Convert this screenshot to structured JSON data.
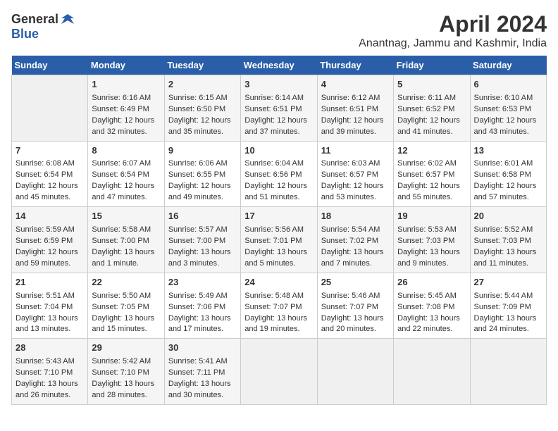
{
  "header": {
    "logo_general": "General",
    "logo_blue": "Blue",
    "month_year": "April 2024",
    "location": "Anantnag, Jammu and Kashmir, India"
  },
  "days_of_week": [
    "Sunday",
    "Monday",
    "Tuesday",
    "Wednesday",
    "Thursday",
    "Friday",
    "Saturday"
  ],
  "weeks": [
    [
      {
        "day": "",
        "data": ""
      },
      {
        "day": "1",
        "data": "Sunrise: 6:16 AM\nSunset: 6:49 PM\nDaylight: 12 hours and 32 minutes."
      },
      {
        "day": "2",
        "data": "Sunrise: 6:15 AM\nSunset: 6:50 PM\nDaylight: 12 hours and 35 minutes."
      },
      {
        "day": "3",
        "data": "Sunrise: 6:14 AM\nSunset: 6:51 PM\nDaylight: 12 hours and 37 minutes."
      },
      {
        "day": "4",
        "data": "Sunrise: 6:12 AM\nSunset: 6:51 PM\nDaylight: 12 hours and 39 minutes."
      },
      {
        "day": "5",
        "data": "Sunrise: 6:11 AM\nSunset: 6:52 PM\nDaylight: 12 hours and 41 minutes."
      },
      {
        "day": "6",
        "data": "Sunrise: 6:10 AM\nSunset: 6:53 PM\nDaylight: 12 hours and 43 minutes."
      }
    ],
    [
      {
        "day": "7",
        "data": "Sunrise: 6:08 AM\nSunset: 6:54 PM\nDaylight: 12 hours and 45 minutes."
      },
      {
        "day": "8",
        "data": "Sunrise: 6:07 AM\nSunset: 6:54 PM\nDaylight: 12 hours and 47 minutes."
      },
      {
        "day": "9",
        "data": "Sunrise: 6:06 AM\nSunset: 6:55 PM\nDaylight: 12 hours and 49 minutes."
      },
      {
        "day": "10",
        "data": "Sunrise: 6:04 AM\nSunset: 6:56 PM\nDaylight: 12 hours and 51 minutes."
      },
      {
        "day": "11",
        "data": "Sunrise: 6:03 AM\nSunset: 6:57 PM\nDaylight: 12 hours and 53 minutes."
      },
      {
        "day": "12",
        "data": "Sunrise: 6:02 AM\nSunset: 6:57 PM\nDaylight: 12 hours and 55 minutes."
      },
      {
        "day": "13",
        "data": "Sunrise: 6:01 AM\nSunset: 6:58 PM\nDaylight: 12 hours and 57 minutes."
      }
    ],
    [
      {
        "day": "14",
        "data": "Sunrise: 5:59 AM\nSunset: 6:59 PM\nDaylight: 12 hours and 59 minutes."
      },
      {
        "day": "15",
        "data": "Sunrise: 5:58 AM\nSunset: 7:00 PM\nDaylight: 13 hours and 1 minute."
      },
      {
        "day": "16",
        "data": "Sunrise: 5:57 AM\nSunset: 7:00 PM\nDaylight: 13 hours and 3 minutes."
      },
      {
        "day": "17",
        "data": "Sunrise: 5:56 AM\nSunset: 7:01 PM\nDaylight: 13 hours and 5 minutes."
      },
      {
        "day": "18",
        "data": "Sunrise: 5:54 AM\nSunset: 7:02 PM\nDaylight: 13 hours and 7 minutes."
      },
      {
        "day": "19",
        "data": "Sunrise: 5:53 AM\nSunset: 7:03 PM\nDaylight: 13 hours and 9 minutes."
      },
      {
        "day": "20",
        "data": "Sunrise: 5:52 AM\nSunset: 7:03 PM\nDaylight: 13 hours and 11 minutes."
      }
    ],
    [
      {
        "day": "21",
        "data": "Sunrise: 5:51 AM\nSunset: 7:04 PM\nDaylight: 13 hours and 13 minutes."
      },
      {
        "day": "22",
        "data": "Sunrise: 5:50 AM\nSunset: 7:05 PM\nDaylight: 13 hours and 15 minutes."
      },
      {
        "day": "23",
        "data": "Sunrise: 5:49 AM\nSunset: 7:06 PM\nDaylight: 13 hours and 17 minutes."
      },
      {
        "day": "24",
        "data": "Sunrise: 5:48 AM\nSunset: 7:07 PM\nDaylight: 13 hours and 19 minutes."
      },
      {
        "day": "25",
        "data": "Sunrise: 5:46 AM\nSunset: 7:07 PM\nDaylight: 13 hours and 20 minutes."
      },
      {
        "day": "26",
        "data": "Sunrise: 5:45 AM\nSunset: 7:08 PM\nDaylight: 13 hours and 22 minutes."
      },
      {
        "day": "27",
        "data": "Sunrise: 5:44 AM\nSunset: 7:09 PM\nDaylight: 13 hours and 24 minutes."
      }
    ],
    [
      {
        "day": "28",
        "data": "Sunrise: 5:43 AM\nSunset: 7:10 PM\nDaylight: 13 hours and 26 minutes."
      },
      {
        "day": "29",
        "data": "Sunrise: 5:42 AM\nSunset: 7:10 PM\nDaylight: 13 hours and 28 minutes."
      },
      {
        "day": "30",
        "data": "Sunrise: 5:41 AM\nSunset: 7:11 PM\nDaylight: 13 hours and 30 minutes."
      },
      {
        "day": "",
        "data": ""
      },
      {
        "day": "",
        "data": ""
      },
      {
        "day": "",
        "data": ""
      },
      {
        "day": "",
        "data": ""
      }
    ]
  ]
}
